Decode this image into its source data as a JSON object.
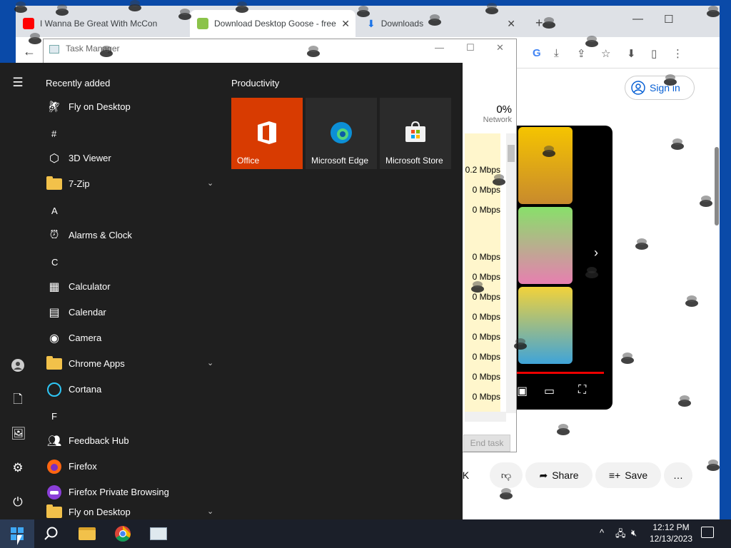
{
  "browser": {
    "tabs": [
      {
        "label": "I Wanna Be Great With McCon",
        "favicon": "youtube-icon",
        "color": "#ff0000"
      },
      {
        "label": "Download Desktop Goose - free",
        "favicon": "download-site-icon",
        "color": "#8bc34a"
      },
      {
        "label": "Downloads",
        "favicon": "download-arrow-icon",
        "color": "#1a73e8"
      }
    ],
    "new_tab": "+",
    "back": "←",
    "window_controls": {
      "minimize": "—",
      "maximize": "☐"
    },
    "toolbar_icons": [
      "google-icon",
      "download-icon",
      "share-icon",
      "bookmark-star-icon",
      "downloads-icon",
      "sidebar-icon",
      "menu-icon"
    ],
    "youtube": {
      "sign_in": "Sign in",
      "likes": "7K",
      "share": "Share",
      "save": "Save",
      "more": "…"
    }
  },
  "task_manager": {
    "title": "Task Manager",
    "network_pct": "0%",
    "network_label": "Network",
    "network_values": [
      "0.2 Mbps",
      "0 Mbps",
      "0 Mbps",
      "0 Mbps",
      "0 Mbps",
      "0 Mbps",
      "0 Mbps",
      "0 Mbps",
      "0 Mbps",
      "0 Mbps",
      "0 Mbps"
    ],
    "end_task": "End task"
  },
  "start_menu": {
    "recent_header": "Recently added",
    "tiles_header": "Productivity",
    "apps": [
      {
        "kind": "app",
        "label": "Fly on Desktop",
        "icon": "fly-icon"
      },
      {
        "kind": "letter",
        "label": "#"
      },
      {
        "kind": "app",
        "label": "3D Viewer",
        "icon": "cube-icon"
      },
      {
        "kind": "folder",
        "label": "7-Zip",
        "icon": "folder-icon",
        "expand": "⌄"
      },
      {
        "kind": "letter",
        "label": "A"
      },
      {
        "kind": "app",
        "label": "Alarms & Clock",
        "icon": "alarm-clock-icon"
      },
      {
        "kind": "letter",
        "label": "C"
      },
      {
        "kind": "app",
        "label": "Calculator",
        "icon": "calculator-icon"
      },
      {
        "kind": "app",
        "label": "Calendar",
        "icon": "calendar-icon"
      },
      {
        "kind": "app",
        "label": "Camera",
        "icon": "camera-icon"
      },
      {
        "kind": "folder",
        "label": "Chrome Apps",
        "icon": "folder-icon",
        "expand": "⌄"
      },
      {
        "kind": "app",
        "label": "Cortana",
        "icon": "cortana-icon"
      },
      {
        "kind": "letter",
        "label": "F"
      },
      {
        "kind": "app",
        "label": "Feedback Hub",
        "icon": "feedback-hub-icon"
      },
      {
        "kind": "app",
        "label": "Firefox",
        "icon": "firefox-icon"
      },
      {
        "kind": "app",
        "label": "Firefox Private Browsing",
        "icon": "firefox-private-icon"
      },
      {
        "kind": "folder",
        "label": "Fly on Desktop",
        "icon": "folder-icon",
        "expand": "⌄"
      }
    ],
    "tiles": [
      {
        "label": "Office",
        "icon": "office-icon",
        "bg": "#d83b01"
      },
      {
        "label": "Microsoft Edge",
        "icon": "edge-icon",
        "bg": "#2b2b2b"
      },
      {
        "label": "Microsoft Store",
        "icon": "store-icon",
        "bg": "#2b2b2b"
      }
    ],
    "rail": [
      "hamburger-menu-icon",
      "user-icon",
      "documents-icon",
      "pictures-icon",
      "settings-icon",
      "power-icon"
    ]
  },
  "taskbar": {
    "pinned": [
      "start-icon",
      "search-icon",
      "file-explorer-icon",
      "chrome-icon",
      "task-manager-icon"
    ],
    "tray_chevron": "^",
    "time": "12:12 PM",
    "date": "12/13/2023"
  }
}
